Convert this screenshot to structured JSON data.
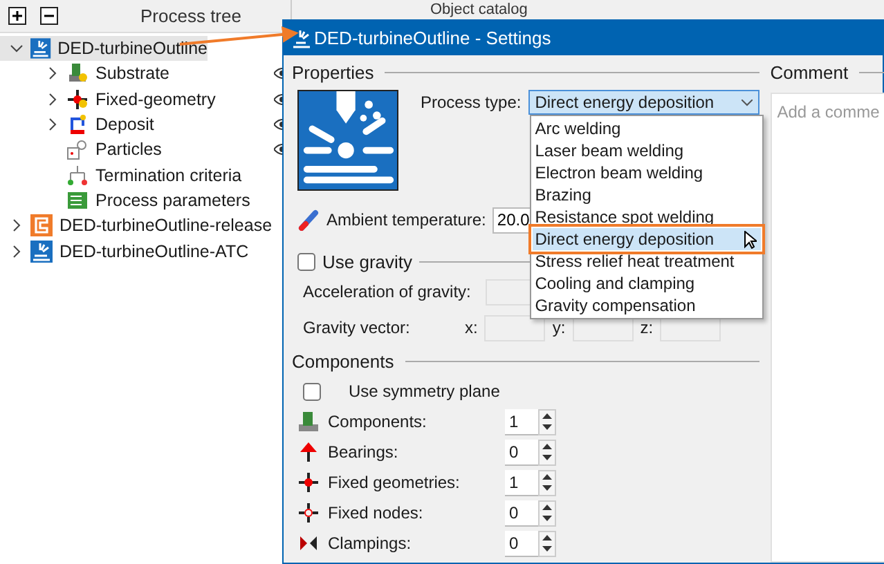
{
  "process_tree": {
    "title": "Process tree",
    "items": [
      {
        "label": "DED-turbineOutline",
        "kind": "process",
        "selected": true,
        "expanded": true,
        "children": [
          {
            "label": "Substrate",
            "kind": "substrate",
            "selected": false,
            "expanded": false,
            "visible": true
          },
          {
            "label": "Fixed-geometry",
            "kind": "fixture",
            "selected": false,
            "expanded": false,
            "visible": true
          },
          {
            "label": "Deposit",
            "kind": "deposit",
            "selected": false,
            "expanded": false,
            "visible": true
          },
          {
            "label": "Particles",
            "kind": "particles",
            "selected": false,
            "visible": true
          },
          {
            "label": "Termination criteria",
            "kind": "termination",
            "selected": false
          },
          {
            "label": "Process parameters",
            "kind": "parameters",
            "selected": false
          }
        ]
      },
      {
        "label": "DED-turbineOutline-release",
        "kind": "release",
        "selected": false,
        "expanded": false
      },
      {
        "label": "DED-turbineOutline-ATC",
        "kind": "process",
        "selected": false,
        "expanded": false
      }
    ]
  },
  "object_catalog": {
    "title": "Object catalog"
  },
  "dialog": {
    "title": "DED-turbineOutline - Settings",
    "properties": {
      "heading": "Properties",
      "process_type": {
        "label": "Process type:",
        "value": "Direct energy deposition",
        "open": true,
        "options": [
          {
            "label": "Arc welding",
            "selected": false
          },
          {
            "label": "Laser beam welding",
            "selected": false
          },
          {
            "label": "Electron beam welding",
            "selected": false
          },
          {
            "label": "Brazing",
            "selected": false
          },
          {
            "label": "Resistance spot welding",
            "selected": false
          },
          {
            "label": "Direct energy deposition",
            "selected": true
          },
          {
            "label": "Stress relief heat treatment",
            "selected": false
          },
          {
            "label": "Cooling and clamping",
            "selected": false
          },
          {
            "label": "Gravity compensation",
            "selected": false
          }
        ]
      },
      "ambient_temperature": {
        "label": "Ambient temperature:",
        "value": "20.0"
      },
      "use_gravity": {
        "label": "Use gravity",
        "checked": false
      },
      "acceleration": {
        "label": "Acceleration of gravity:"
      },
      "gravity_vector": {
        "label": "Gravity vector:",
        "axes": [
          "x:",
          "y:",
          "z:"
        ]
      }
    },
    "components": {
      "heading": "Components",
      "use_symmetry_plane": {
        "label": "Use symmetry plane",
        "checked": false
      },
      "rows": [
        {
          "kind": "components",
          "label": "Components:",
          "value": "1"
        },
        {
          "kind": "bearings",
          "label": "Bearings:",
          "value": "0"
        },
        {
          "kind": "fixed_geometries",
          "label": "Fixed geometries:",
          "value": "1"
        },
        {
          "kind": "fixed_nodes",
          "label": "Fixed nodes:",
          "value": "0"
        },
        {
          "kind": "clampings",
          "label": "Clampings:",
          "value": "0"
        }
      ]
    },
    "comment": {
      "heading": "Comment",
      "placeholder": "Add a comme"
    }
  }
}
